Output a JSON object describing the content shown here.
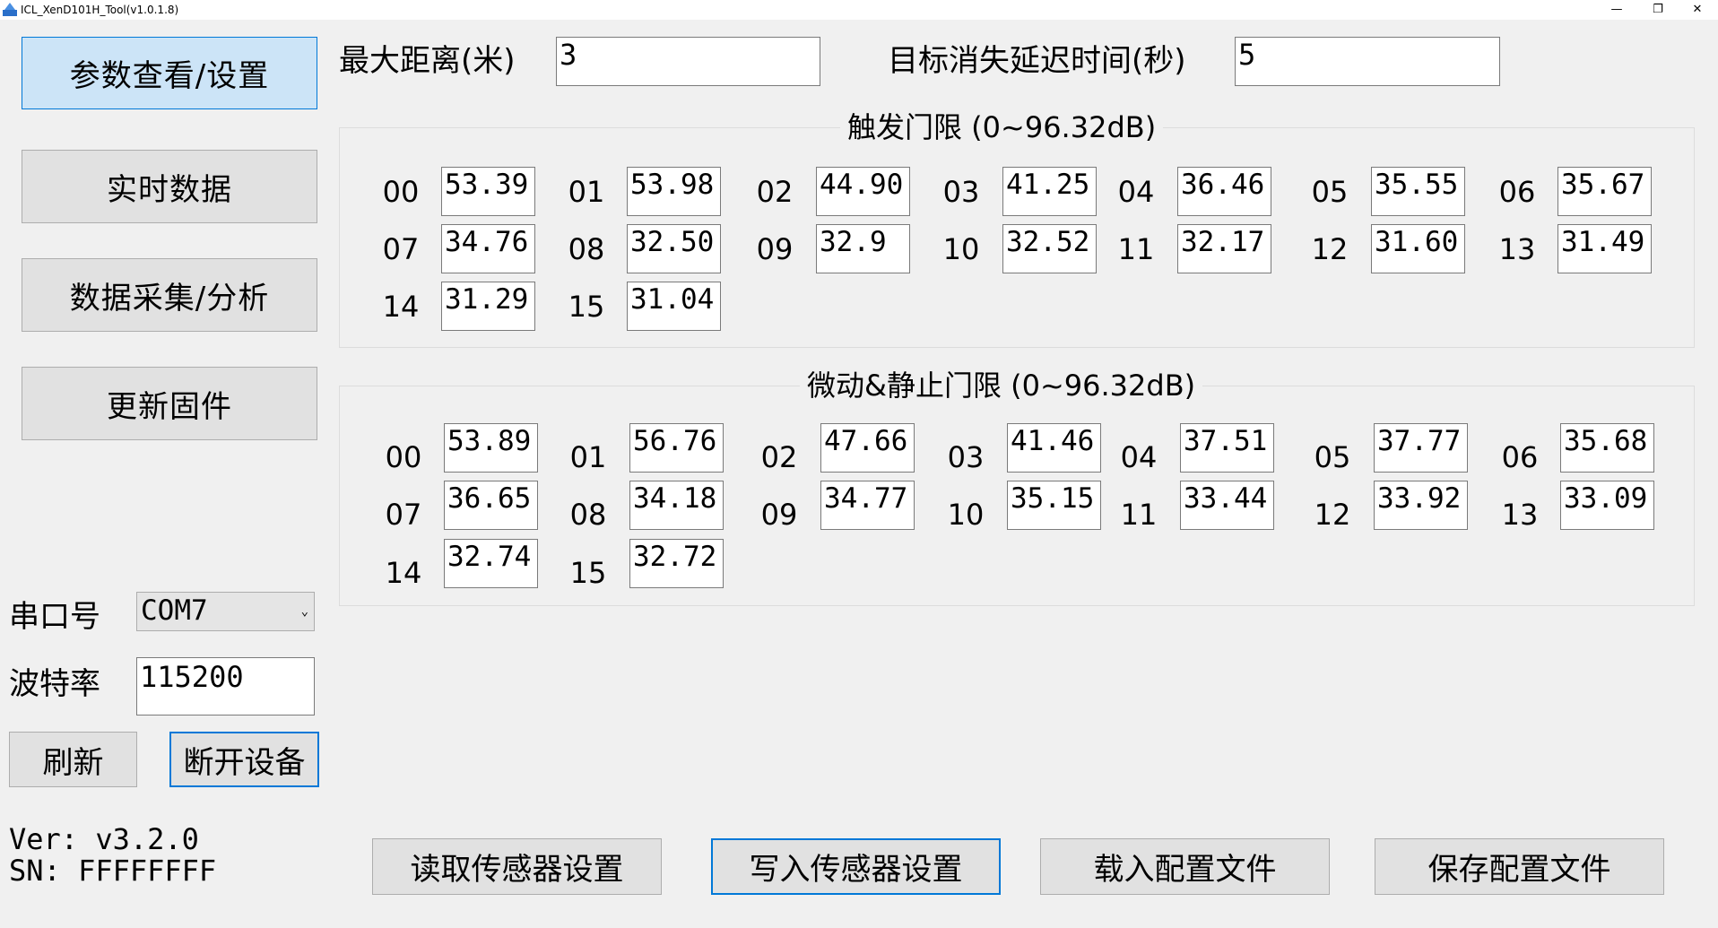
{
  "window": {
    "title": "ICL_XenD101H_Tool(v1.0.1.8)",
    "minimize": "—",
    "maximize": "❐",
    "close": "✕"
  },
  "nav": [
    {
      "label": "参数查看/设置",
      "active": true
    },
    {
      "label": "实时数据",
      "active": false
    },
    {
      "label": "数据采集/分析",
      "active": false
    },
    {
      "label": "更新固件",
      "active": false
    }
  ],
  "params": {
    "max_distance_label": "最大距离(米)",
    "max_distance_value": "3",
    "delay_label": "目标消失延迟时间(秒)",
    "delay_value": "5"
  },
  "trigger": {
    "title": "触发门限 (0~96.32dB)",
    "gates": [
      {
        "idx": "00",
        "val": "53.39"
      },
      {
        "idx": "01",
        "val": "53.98"
      },
      {
        "idx": "02",
        "val": "44.90"
      },
      {
        "idx": "03",
        "val": "41.25"
      },
      {
        "idx": "04",
        "val": "36.46"
      },
      {
        "idx": "05",
        "val": "35.55"
      },
      {
        "idx": "06",
        "val": "35.67"
      },
      {
        "idx": "07",
        "val": "34.76"
      },
      {
        "idx": "08",
        "val": "32.50"
      },
      {
        "idx": "09",
        "val": "32.9"
      },
      {
        "idx": "10",
        "val": "32.52"
      },
      {
        "idx": "11",
        "val": "32.17"
      },
      {
        "idx": "12",
        "val": "31.60"
      },
      {
        "idx": "13",
        "val": "31.49"
      },
      {
        "idx": "14",
        "val": "31.29"
      },
      {
        "idx": "15",
        "val": "31.04"
      }
    ]
  },
  "static": {
    "title": "微动&静止门限 (0~96.32dB)",
    "gates": [
      {
        "idx": "00",
        "val": "53.89"
      },
      {
        "idx": "01",
        "val": "56.76"
      },
      {
        "idx": "02",
        "val": "47.66"
      },
      {
        "idx": "03",
        "val": "41.46"
      },
      {
        "idx": "04",
        "val": "37.51"
      },
      {
        "idx": "05",
        "val": "37.77"
      },
      {
        "idx": "06",
        "val": "35.68"
      },
      {
        "idx": "07",
        "val": "36.65"
      },
      {
        "idx": "08",
        "val": "34.18"
      },
      {
        "idx": "09",
        "val": "34.77"
      },
      {
        "idx": "10",
        "val": "35.15"
      },
      {
        "idx": "11",
        "val": "33.44"
      },
      {
        "idx": "12",
        "val": "33.92"
      },
      {
        "idx": "13",
        "val": "33.09"
      },
      {
        "idx": "14",
        "val": "32.74"
      },
      {
        "idx": "15",
        "val": "32.72"
      }
    ]
  },
  "serial": {
    "port_label": "串口号",
    "port_value": "COM7",
    "baud_label": "波特率",
    "baud_value": "115200",
    "refresh": "刷新",
    "disconnect": "断开设备"
  },
  "info": {
    "ver": "Ver: v3.2.0",
    "sn": "SN: FFFFFFFF"
  },
  "actions": {
    "read": "读取传感器设置",
    "write": "写入传感器设置",
    "load": "载入配置文件",
    "save": "保存配置文件"
  },
  "icons": {
    "app": "app-icon",
    "combo": "chevron-down-icon"
  }
}
